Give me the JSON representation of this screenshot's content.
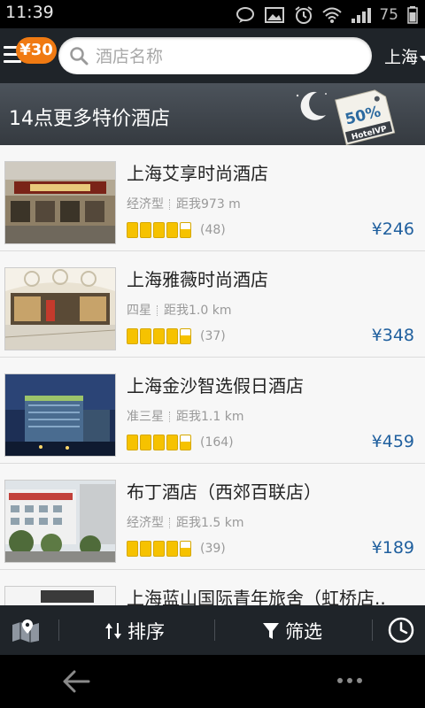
{
  "status_bar": {
    "time": "11:39",
    "battery": "75"
  },
  "header": {
    "coupon": "¥30",
    "search_placeholder": "酒店名称",
    "city": "上海"
  },
  "promo": {
    "title": "14点更多特价酒店",
    "tag_percent": "50%",
    "tag_brand": "HotelVP"
  },
  "hotels": [
    {
      "name": "上海艾享时尚酒店",
      "category": "经济型",
      "distance": "距我973 m",
      "reviews": "(48)",
      "price": "¥246"
    },
    {
      "name": "上海雅薇时尚酒店",
      "category": "四星",
      "distance": "距我1.0 km",
      "reviews": "(37)",
      "price": "¥348"
    },
    {
      "name": "上海金沙智选假日酒店",
      "category": "准三星",
      "distance": "距我1.1 km",
      "reviews": "(164)",
      "price": "¥459"
    },
    {
      "name": "布丁酒店（西郊百联店）",
      "category": "经济型",
      "distance": "距我1.5 km",
      "reviews": "(39)",
      "price": "¥189"
    },
    {
      "name": "上海蓝山国际青年旅舍（虹桥店..",
      "category": "",
      "distance": "",
      "reviews": "",
      "price": ""
    }
  ],
  "bottom_bar": {
    "sort": "排序",
    "filter": "筛选"
  },
  "icons": {
    "menu": "menu-icon",
    "search": "search-icon",
    "map": "map-icon",
    "sort": "sort-icon",
    "filter": "filter-icon",
    "history": "clock-icon",
    "back": "back-arrow-icon",
    "more": "more-icon"
  },
  "colors": {
    "accent": "#f07a12",
    "price": "#1f5f9e",
    "star": "#f6c200",
    "bar": "#1f2429"
  }
}
